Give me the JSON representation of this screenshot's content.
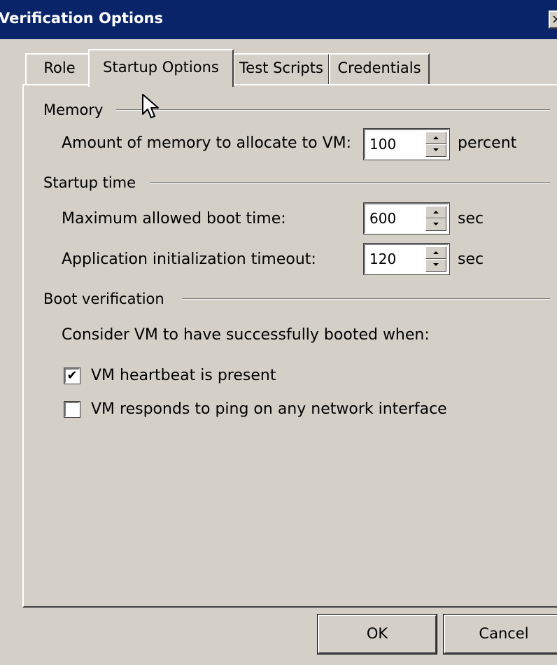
{
  "window": {
    "title": "Verification Options",
    "close_glyph": "×"
  },
  "tabs": [
    {
      "label": "Role"
    },
    {
      "label": "Startup Options"
    },
    {
      "label": "Test Scripts"
    },
    {
      "label": "Credentials"
    }
  ],
  "memory": {
    "group_label": "Memory",
    "amount_label": "Amount of memory to allocate to VM:",
    "amount_value": "100",
    "unit": "percent"
  },
  "startup_time": {
    "group_label": "Startup time",
    "boot_label": "Maximum allowed boot time:",
    "boot_value": "600",
    "boot_unit": "sec",
    "init_label": "Application initialization timeout:",
    "init_value": "120",
    "init_unit": "sec"
  },
  "boot_verification": {
    "group_label": "Boot verification",
    "consider_label": "Consider VM to have successfully booted when:",
    "heartbeat_label": "VM heartbeat is present",
    "heartbeat_checked": "✔",
    "ping_label": "VM responds to ping on any network interface"
  },
  "buttons": {
    "ok": "OK",
    "cancel": "Cancel"
  },
  "icons": {
    "spin_up": "spin-up-arrow-icon",
    "spin_down": "spin-down-arrow-icon",
    "cursor": "mouse-pointer-icon"
  }
}
